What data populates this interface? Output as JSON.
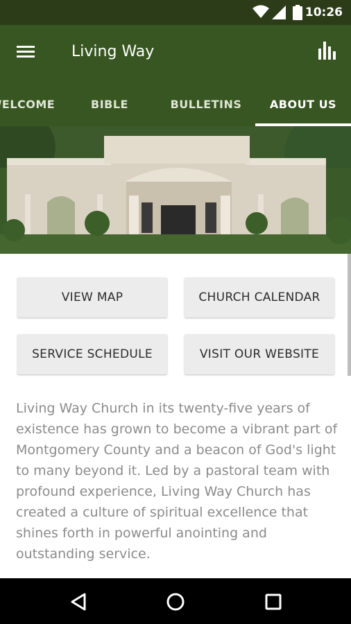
{
  "status_bar": {
    "time": "10:26"
  },
  "app_bar": {
    "title": "Living Way"
  },
  "tabs": [
    {
      "label": "WELCOME"
    },
    {
      "label": "BIBLE"
    },
    {
      "label": "BULLETINS"
    },
    {
      "label": "ABOUT US",
      "selected": true
    }
  ],
  "actions": {
    "view_map": "VIEW MAP",
    "church_calendar": "CHURCH CALENDAR",
    "service_schedule": "SERVICE SCHEDULE",
    "visit_website": "VISIT OUR WEBSITE"
  },
  "description": "Living Way Church in its twenty-five years of existence has grown to become a vibrant part of Montgomery County and a beacon of God's light to many beyond it. Led by a pastoral team with profound experience, Living Way Church has created a culture of spiritual excellence that shines forth in powerful anointing and outstanding service.",
  "colors": {
    "status_bar": "#2c3c19",
    "app_bar": "#385622",
    "button_bg": "#ececec",
    "body_text": "#8b8b8b"
  },
  "icons": [
    "wifi-icon",
    "signal-icon",
    "battery-icon",
    "menu-icon",
    "bar-chart-icon",
    "back-icon",
    "home-icon",
    "recents-icon"
  ]
}
